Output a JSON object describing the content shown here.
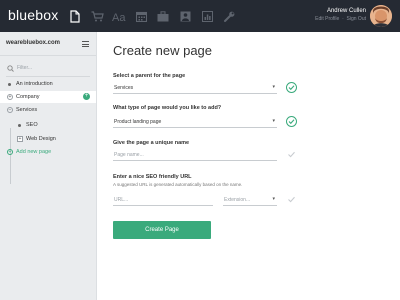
{
  "app": {
    "brand": "bluebox",
    "nav_icons": [
      "document-icon",
      "cart-icon",
      "typography-icon",
      "calendar-icon",
      "briefcase-icon",
      "person-icon",
      "chart-icon",
      "wrench-icon"
    ],
    "user_name": "Andrew Cullen",
    "edit_profile": "Edit Profile",
    "sign_out": "Sign Out"
  },
  "sidebar": {
    "site": "wearebluebox.com",
    "filter_placeholder": "Filter...",
    "items": [
      {
        "label": "An introduction"
      },
      {
        "label": "Company"
      },
      {
        "label": "Services"
      },
      {
        "label": "SEO"
      },
      {
        "label": "Web Design"
      },
      {
        "label": "Add new page"
      }
    ]
  },
  "main": {
    "title": "Create new page",
    "parent_label": "Select a parent for the page",
    "parent_value": "Services",
    "type_label": "What type of page would you like to add?",
    "type_value": "Product landing page",
    "name_label": "Give the page a unique name",
    "name_placeholder": "Page name...",
    "seo_label": "Enter a nice SEO friendly URL",
    "seo_note": "A suggested URL is generated automatically based on the name.",
    "url_placeholder": "URL...",
    "extension_placeholder": "Extension...",
    "create_button": "Create Page"
  },
  "colors": {
    "topbar": "#252a33",
    "accent": "#3aaa7c",
    "sidebar": "#eaecee"
  }
}
